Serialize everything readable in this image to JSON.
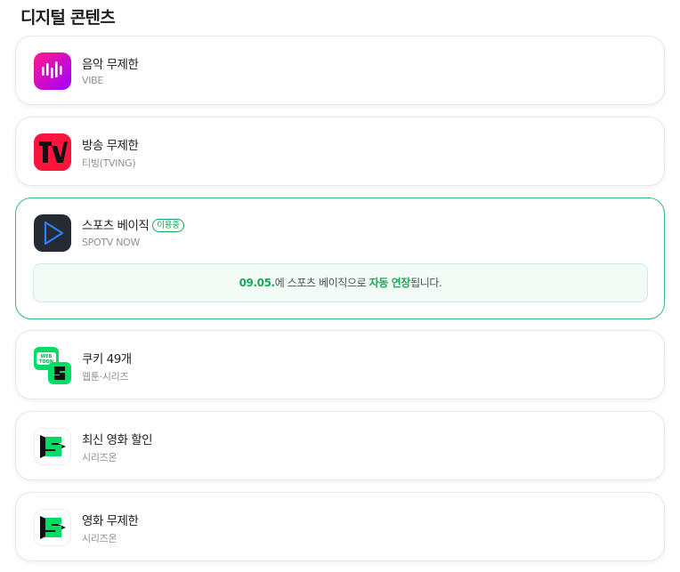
{
  "section": {
    "title": "디지털 콘텐츠"
  },
  "items": [
    {
      "title": "음악 무제한",
      "subtitle": "VIBE",
      "icon": "vibe-logo-icon"
    },
    {
      "title": "방송 무제한",
      "subtitle": "티빙(TVING)",
      "icon": "tving-logo-icon"
    },
    {
      "title": "스포츠 베이직",
      "subtitle": "SPOTV NOW",
      "icon": "spotv-play-icon",
      "badge": "이용중"
    },
    {
      "title": "쿠키 49개",
      "subtitle": "웹툰·시리즈",
      "icon": "webtoon-series-icon"
    },
    {
      "title": "최신 영화 할인",
      "subtitle": "시리즈온",
      "icon": "series-on-logo-icon"
    },
    {
      "title": "영화 무제한",
      "subtitle": "시리즈온",
      "icon": "series-on-logo-icon"
    }
  ],
  "notice": {
    "date": "09.05.",
    "text1": "에 스포츠 베이직으로 ",
    "highlight": "자동 연장",
    "text2": "됩니다."
  },
  "colors": {
    "accent": "#1aa956",
    "border_active": "#2ebf6b",
    "notice_bg": "#f2fbf5"
  }
}
